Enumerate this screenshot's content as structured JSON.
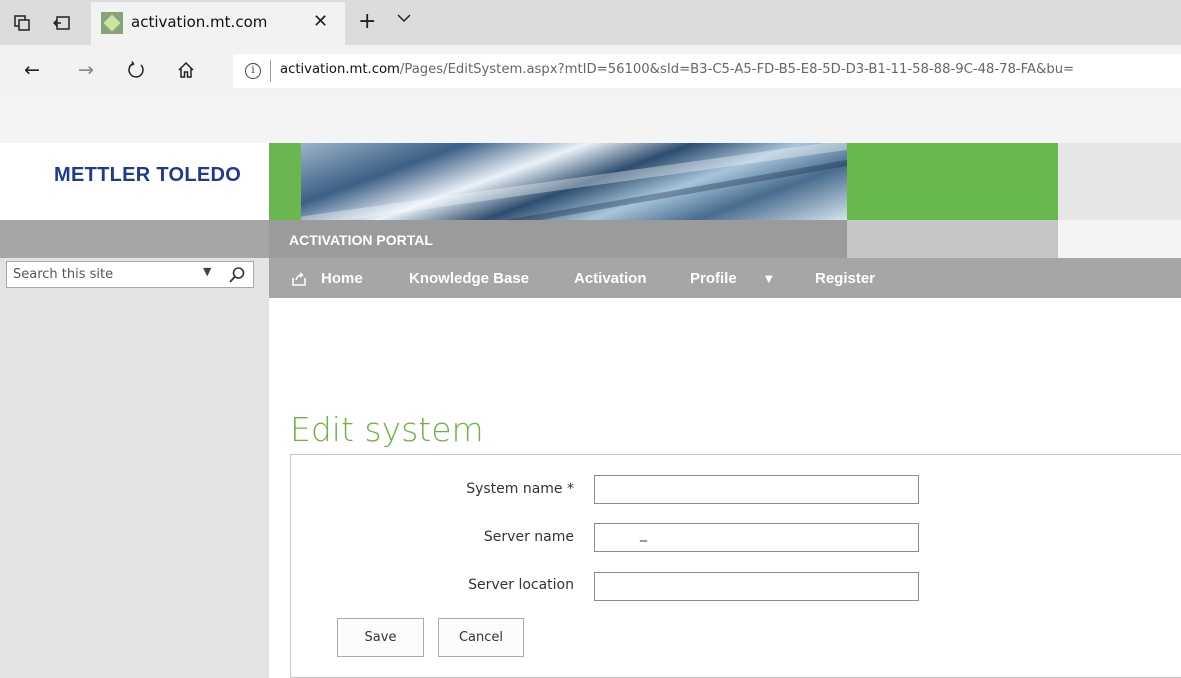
{
  "browser": {
    "tab_title": "activation.mt.com",
    "url_domain": "activation.mt.com",
    "url_path": "/Pages/EditSystem.aspx?mtID=56100&sId=B3-C5-A5-FD-B5-E8-5D-D3-B1-11-58-88-9C-48-78-FA&bu="
  },
  "site": {
    "logo_text": "METTLER TOLEDO",
    "portal_title": "ACTIVATION PORTAL",
    "search_placeholder": "Search this site",
    "brand_green": "#6cb543",
    "logo_blue": "#1f3a93"
  },
  "nav": {
    "items": [
      {
        "label": "Home"
      },
      {
        "label": "Knowledge Base"
      },
      {
        "label": "Activation"
      },
      {
        "label": "Profile"
      },
      {
        "label": "Register"
      }
    ]
  },
  "form": {
    "title": "Edit system",
    "fields": [
      {
        "label": "System name *",
        "value": ""
      },
      {
        "label": "Server name",
        "value": "_"
      },
      {
        "label": "Server location",
        "value": ""
      }
    ],
    "save_label": "Save",
    "cancel_label": "Cancel"
  }
}
